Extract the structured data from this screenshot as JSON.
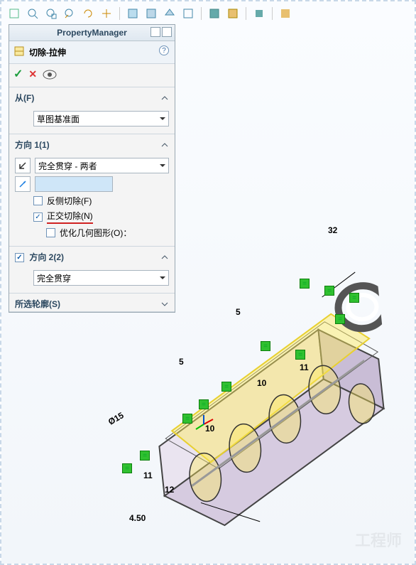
{
  "toolbar": {
    "icons": [
      "view-orientation",
      "zoom-fit",
      "zoom-area",
      "zoom-prev",
      "rotate",
      "pan",
      "section-view",
      "display-style",
      "perspective",
      "wireframe",
      "shaded",
      "shaded-edges",
      "shadow",
      "scene"
    ]
  },
  "panel": {
    "title": "PropertyManager",
    "feature_name": "切除-拉伸",
    "ok": "✓",
    "cancel": "✕",
    "help": "?",
    "from": {
      "label": "从(F)",
      "value": "草图基准面"
    },
    "dir1": {
      "label": "方向 1(1)",
      "end_condition": "完全贯穿 - 两者",
      "reverse_label": "反侧切除(F)",
      "reverse_checked": false,
      "normal_label": "正交切除(N)",
      "normal_checked": true,
      "optimize_label": "优化几何图形(O)：",
      "optimize_checked": false,
      "draft_value": ""
    },
    "dir2": {
      "label": "方向 2(2)",
      "checked": true,
      "end_condition": "完全贯穿"
    },
    "contours": {
      "label": "所选轮廓(S)"
    }
  },
  "dims": {
    "d_top": "32",
    "d_5a": "5",
    "d_10a": "10",
    "d_11a": "11",
    "d_5b": "5",
    "d_10b": "10",
    "d_11b": "11",
    "d_diam": "Ø15",
    "d_12": "12",
    "d_bottom": "4.50"
  },
  "watermark": "工程师"
}
